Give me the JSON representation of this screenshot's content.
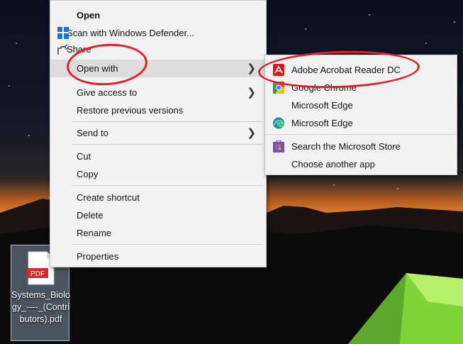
{
  "context_menu": {
    "open": "Open",
    "scan": "Scan with Windows Defender...",
    "share": "Share",
    "open_with": "Open with",
    "give_access": "Give access to",
    "restore": "Restore previous versions",
    "send_to": "Send to",
    "cut": "Cut",
    "copy": "Copy",
    "create_shortcut": "Create shortcut",
    "delete": "Delete",
    "rename": "Rename",
    "properties": "Properties"
  },
  "submenu": {
    "acrobat": "Adobe Acrobat Reader DC",
    "chrome": "Google Chrome",
    "edge_1": "Microsoft Edge",
    "edge_2": "Microsoft Edge",
    "store": "Search the Microsoft Store",
    "choose": "Choose another app"
  },
  "desktop_file": {
    "badge": "PDF",
    "name": "Systems_Biology_----_(Contributors).pdf"
  },
  "colors": {
    "annotation": "#e0202a",
    "menu_bg": "#f2f2f2",
    "hover_bg": "#dcdcdc"
  }
}
